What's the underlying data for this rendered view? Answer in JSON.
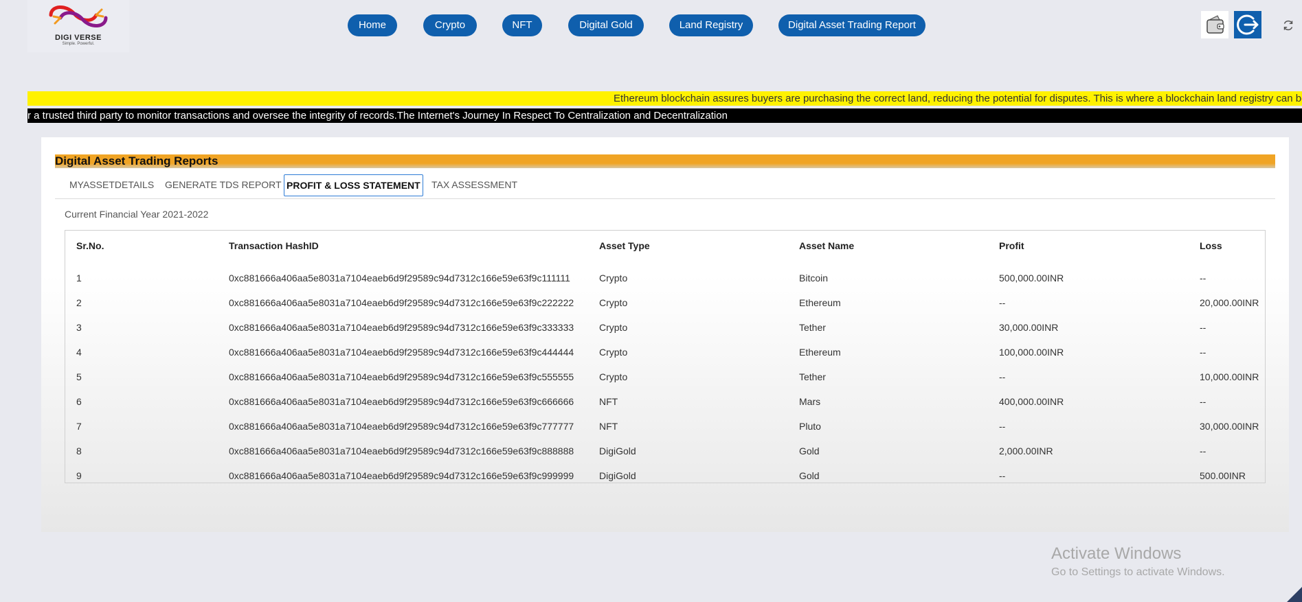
{
  "logo": {
    "name": "DIGI VERSE",
    "tagline": "Simple. Powerful."
  },
  "nav": [
    "Home",
    "Crypto",
    "NFT",
    "Digital Gold",
    "Land Registry",
    "Digital Asset Trading Report"
  ],
  "tickers": {
    "yellow": "Ethereum blockchain assures buyers are purchasing the correct land, reducing the potential for disputes. This is where a blockchain land registry can become",
    "black": "r a trusted third party to monitor transactions and oversee the integrity of records.The Internet's Journey In Respect To Centralization and Decentralization"
  },
  "report": {
    "title": "Digital Asset Trading Reports",
    "tabs": [
      "MYASSETDETAILS",
      "GENERATE TDS REPORT",
      "PROFIT & LOSS STATEMENT",
      "TAX ASSESSMENT"
    ],
    "active_tab": "PROFIT & LOSS STATEMENT",
    "financial_year": "Current Financial Year 2021-2022",
    "columns": [
      "Sr.No.",
      "Transaction HashID",
      "Asset Type",
      "Asset Name",
      "Profit",
      "Loss"
    ],
    "rows": [
      [
        "1",
        "0xc881666a406aa5e8031a7104eaeb6d9f29589c94d7312c166e59e63f9c111111",
        "Crypto",
        "Bitcoin",
        "500,000.00INR",
        "--"
      ],
      [
        "2",
        "0xc881666a406aa5e8031a7104eaeb6d9f29589c94d7312c166e59e63f9c222222",
        "Crypto",
        "Ethereum",
        "--",
        "20,000.00INR"
      ],
      [
        "3",
        "0xc881666a406aa5e8031a7104eaeb6d9f29589c94d7312c166e59e63f9c333333",
        "Crypto",
        "Tether",
        "30,000.00INR",
        "--"
      ],
      [
        "4",
        "0xc881666a406aa5e8031a7104eaeb6d9f29589c94d7312c166e59e63f9c444444",
        "Crypto",
        "Ethereum",
        "100,000.00INR",
        "--"
      ],
      [
        "5",
        "0xc881666a406aa5e8031a7104eaeb6d9f29589c94d7312c166e59e63f9c555555",
        "Crypto",
        "Tether",
        "--",
        "10,000.00INR"
      ],
      [
        "6",
        "0xc881666a406aa5e8031a7104eaeb6d9f29589c94d7312c166e59e63f9c666666",
        "NFT",
        "Mars",
        "400,000.00INR",
        "--"
      ],
      [
        "7",
        "0xc881666a406aa5e8031a7104eaeb6d9f29589c94d7312c166e59e63f9c777777",
        "NFT",
        "Pluto",
        "--",
        "30,000.00INR"
      ],
      [
        "8",
        "0xc881666a406aa5e8031a7104eaeb6d9f29589c94d7312c166e59e63f9c888888",
        "DigiGold",
        "Gold",
        "2,000.00INR",
        "--"
      ],
      [
        "9",
        "0xc881666a406aa5e8031a7104eaeb6d9f29589c94d7312c166e59e63f9c999999",
        "DigiGold",
        "Gold",
        "--",
        "500.00INR"
      ]
    ]
  },
  "watermark": {
    "line1": "Activate Windows",
    "line2": "Go to Settings to activate Windows."
  },
  "icons": [
    "wallet-icon",
    "logout-icon",
    "refresh-icon"
  ],
  "colors": {
    "nav_bg": "#0f5fad",
    "ticker_yellow": "#fff200",
    "ticker_black": "#000000",
    "header_orange": "#f0a425",
    "active_tab_border": "#2d7bd6"
  }
}
